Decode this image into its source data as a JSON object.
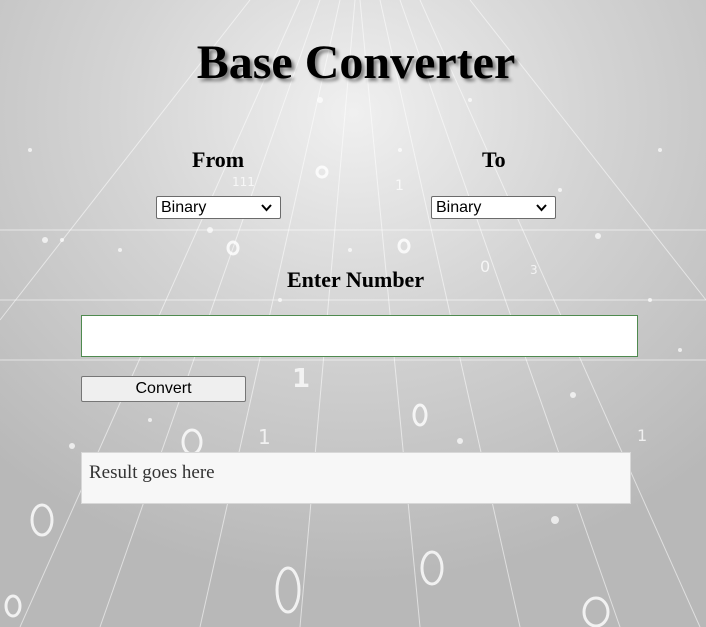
{
  "page": {
    "title": "Base Converter"
  },
  "from": {
    "label": "From",
    "selected": "Binary"
  },
  "to": {
    "label": "To",
    "selected": "Binary"
  },
  "input": {
    "label": "Enter Number",
    "value": ""
  },
  "convert_button": {
    "label": "Convert"
  },
  "result": {
    "text": "Result goes here"
  },
  "colors": {
    "background": "#c9c9c9",
    "input_border": "#4f8a4f",
    "result_background": "#f7f7f7"
  }
}
